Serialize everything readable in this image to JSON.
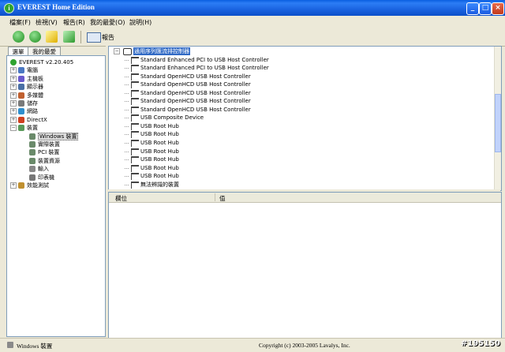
{
  "app": {
    "title": "EVEREST Home Edition",
    "icon_glyph": "i"
  },
  "window_buttons": {
    "minimize": "_",
    "maximize": "□",
    "close": "×"
  },
  "menu": [
    "檔案(F)",
    "檢視(V)",
    "報告(R)",
    "我的最愛(O)",
    "說明(H)"
  ],
  "toolbar": {
    "report_label": "報告"
  },
  "tabs": [
    "選單",
    "我的最愛"
  ],
  "tree": [
    {
      "label": "EVEREST v2.20.405",
      "level": 0,
      "expander": "",
      "icon": "everest-icon"
    },
    {
      "label": "電腦",
      "level": 1,
      "expander": "+",
      "icon": "computer-icon"
    },
    {
      "label": "主機板",
      "level": 1,
      "expander": "+",
      "icon": "motherboard-icon"
    },
    {
      "label": "顯示器",
      "level": 1,
      "expander": "+",
      "icon": "display-icon"
    },
    {
      "label": "多媒體",
      "level": 1,
      "expander": "+",
      "icon": "multimedia-icon"
    },
    {
      "label": "儲存",
      "level": 1,
      "expander": "+",
      "icon": "storage-icon"
    },
    {
      "label": "網路",
      "level": 1,
      "expander": "+",
      "icon": "network-icon"
    },
    {
      "label": "DirectX",
      "level": 1,
      "expander": "+",
      "icon": "directx-icon"
    },
    {
      "label": "裝置",
      "level": 1,
      "expander": "−",
      "icon": "devices-icon"
    },
    {
      "label": "Windows 裝置",
      "level": 2,
      "expander": "",
      "icon": "windows-devices-icon",
      "selected": true
    },
    {
      "label": "實際裝置",
      "level": 2,
      "expander": "",
      "icon": "physical-devices-icon"
    },
    {
      "label": "PCI 裝置",
      "level": 2,
      "expander": "",
      "icon": "pci-devices-icon"
    },
    {
      "label": "裝置資源",
      "level": 2,
      "expander": "",
      "icon": "device-resources-icon"
    },
    {
      "label": "輸入",
      "level": 2,
      "expander": "",
      "icon": "input-icon"
    },
    {
      "label": "印表機",
      "level": 2,
      "expander": "",
      "icon": "printer-icon"
    },
    {
      "label": "效能測試",
      "level": 1,
      "expander": "+",
      "icon": "benchmark-icon"
    }
  ],
  "device_list": {
    "category_label": "通用序列匯流排控制器",
    "items": [
      "Standard Enhanced PCI to USB Host Controller",
      "Standard Enhanced PCI to USB Host Controller",
      "Standard OpenHCD USB Host Controller",
      "Standard OpenHCD USB Host Controller",
      "Standard OpenHCD USB Host Controller",
      "Standard OpenHCD USB Host Controller",
      "Standard OpenHCD USB Host Controller",
      "USB Composite Device",
      "USB Root Hub",
      "USB Root Hub",
      "USB Root Hub",
      "USB Root Hub",
      "USB Root Hub",
      "USB Root Hub",
      "USB Root Hub",
      "無法辨識的裝置"
    ]
  },
  "grid": {
    "col_field": "欄位",
    "col_value": "值"
  },
  "status": {
    "left": "Windows 裝置",
    "center": "Copyright (c) 2003-2005 Lavalys, Inc."
  },
  "watermark": "#195150",
  "colors": {
    "title_bar": "#0b4fc8",
    "selection": "#316ac5"
  }
}
